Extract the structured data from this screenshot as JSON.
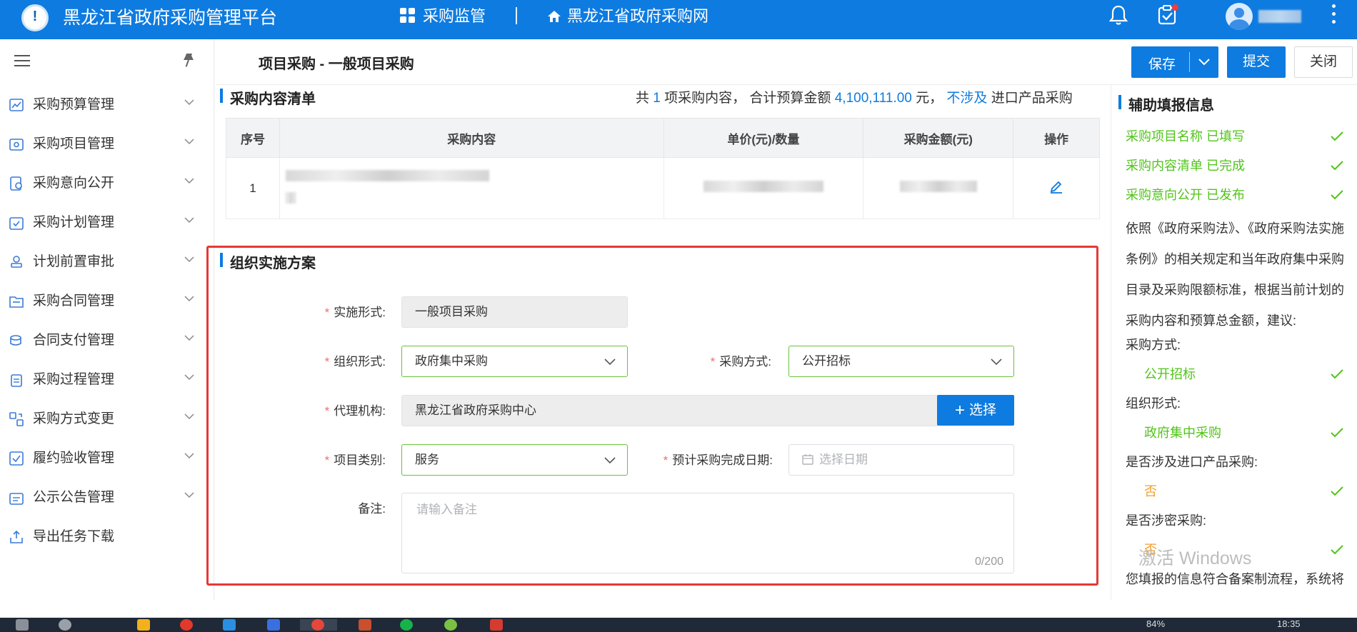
{
  "topbar": {
    "app_title": "黑龙江省政府采购管理平台",
    "nav_supervision": "采购监管",
    "nav_site": "黑龙江省政府采购网"
  },
  "sidebar": {
    "items": [
      {
        "label": "采购预算管理",
        "icon": "chart-icon"
      },
      {
        "label": "采购项目管理",
        "icon": "project-icon"
      },
      {
        "label": "采购意向公开",
        "icon": "intent-icon"
      },
      {
        "label": "采购计划管理",
        "icon": "calendar-check-icon"
      },
      {
        "label": "计划前置审批",
        "icon": "stamp-icon"
      },
      {
        "label": "采购合同管理",
        "icon": "folder-icon"
      },
      {
        "label": "合同支付管理",
        "icon": "coins-icon"
      },
      {
        "label": "采购过程管理",
        "icon": "clipboard-icon"
      },
      {
        "label": "采购方式变更",
        "icon": "switch-icon"
      },
      {
        "label": "履约验收管理",
        "icon": "checkbox-icon"
      },
      {
        "label": "公示公告管理",
        "icon": "notice-icon"
      },
      {
        "label": "导出任务下载",
        "icon": "export-icon"
      }
    ]
  },
  "header": {
    "breadcrumb": "项目采购 - 一般项目采购",
    "save": "保存",
    "submit": "提交",
    "close": "关闭"
  },
  "content_list": {
    "title": "采购内容清单",
    "summary_prefix": "共",
    "count": "1",
    "summary_mid": "项采购内容， 合计预算金额",
    "amount": "4,100,111.00",
    "summary_unit": "元，",
    "import_status": "不涉及",
    "summary_suffix": "进口产品采购",
    "columns": [
      "序号",
      "采购内容",
      "单价(元)/数量",
      "采购金额(元)",
      "操作"
    ],
    "rows": [
      {
        "index": "1"
      }
    ]
  },
  "plan": {
    "title": "组织实施方案",
    "impl_form_label": "实施形式:",
    "impl_form_value": "一般项目采购",
    "org_form_label": "组织形式:",
    "org_form_value": "政府集中采购",
    "method_label": "采购方式:",
    "method_value": "公开招标",
    "agency_label": "代理机构:",
    "agency_value": "黑龙江省政府采购中心",
    "select_button": "选择",
    "category_label": "项目类别:",
    "category_value": "服务",
    "date_label": "预计采购完成日期:",
    "date_placeholder": "选择日期",
    "remark_label": "备注:",
    "remark_placeholder": "请输入备注",
    "remark_count": "0/200"
  },
  "assist": {
    "title": "辅助填报信息",
    "status_lines": [
      "采购项目名称 已填写",
      "采购内容清单 已完成",
      "采购意向公开 已发布"
    ],
    "paragraph": "依照《政府采购法》、《政府采购法实施条例》的相关规定和当年政府集中采购目录及采购限额标准，根据当前计划的采购内容和预算总金额，建议:",
    "method_label": "采购方式:",
    "method_value": "公开招标",
    "org_label": "组织形式:",
    "org_value": "政府集中采购",
    "import_label": "是否涉及进口产品采购:",
    "import_value": "否",
    "secret_label": "是否涉密采购:",
    "secret_value": "否",
    "footer": "您填报的信息符合备案制流程，系统将"
  },
  "watermark": "激活 Windows",
  "taskbar": {
    "battery": "84%",
    "time": "18:35"
  },
  "colors": {
    "primary": "#0e7be0",
    "success": "#52c41a",
    "warning": "#f0a030",
    "danger": "#e53935"
  }
}
